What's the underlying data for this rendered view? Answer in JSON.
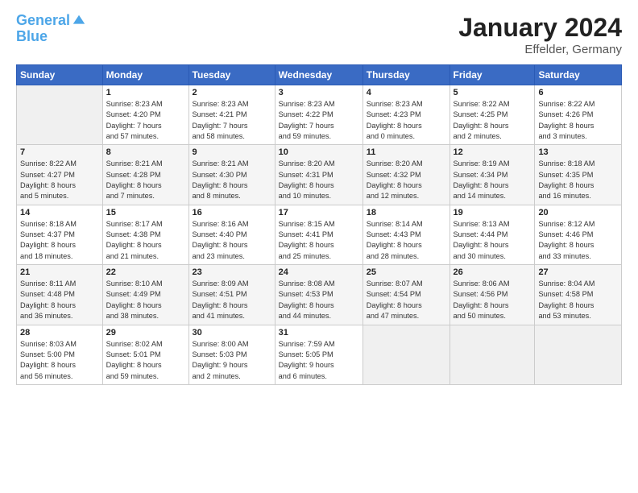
{
  "header": {
    "logo_line1": "General",
    "logo_line2": "Blue",
    "title": "January 2024",
    "subtitle": "Effelder, Germany"
  },
  "weekdays": [
    "Sunday",
    "Monday",
    "Tuesday",
    "Wednesday",
    "Thursday",
    "Friday",
    "Saturday"
  ],
  "weeks": [
    [
      {
        "num": "",
        "info": ""
      },
      {
        "num": "1",
        "info": "Sunrise: 8:23 AM\nSunset: 4:20 PM\nDaylight: 7 hours\nand 57 minutes."
      },
      {
        "num": "2",
        "info": "Sunrise: 8:23 AM\nSunset: 4:21 PM\nDaylight: 7 hours\nand 58 minutes."
      },
      {
        "num": "3",
        "info": "Sunrise: 8:23 AM\nSunset: 4:22 PM\nDaylight: 7 hours\nand 59 minutes."
      },
      {
        "num": "4",
        "info": "Sunrise: 8:23 AM\nSunset: 4:23 PM\nDaylight: 8 hours\nand 0 minutes."
      },
      {
        "num": "5",
        "info": "Sunrise: 8:22 AM\nSunset: 4:25 PM\nDaylight: 8 hours\nand 2 minutes."
      },
      {
        "num": "6",
        "info": "Sunrise: 8:22 AM\nSunset: 4:26 PM\nDaylight: 8 hours\nand 3 minutes."
      }
    ],
    [
      {
        "num": "7",
        "info": "Sunrise: 8:22 AM\nSunset: 4:27 PM\nDaylight: 8 hours\nand 5 minutes."
      },
      {
        "num": "8",
        "info": "Sunrise: 8:21 AM\nSunset: 4:28 PM\nDaylight: 8 hours\nand 7 minutes."
      },
      {
        "num": "9",
        "info": "Sunrise: 8:21 AM\nSunset: 4:30 PM\nDaylight: 8 hours\nand 8 minutes."
      },
      {
        "num": "10",
        "info": "Sunrise: 8:20 AM\nSunset: 4:31 PM\nDaylight: 8 hours\nand 10 minutes."
      },
      {
        "num": "11",
        "info": "Sunrise: 8:20 AM\nSunset: 4:32 PM\nDaylight: 8 hours\nand 12 minutes."
      },
      {
        "num": "12",
        "info": "Sunrise: 8:19 AM\nSunset: 4:34 PM\nDaylight: 8 hours\nand 14 minutes."
      },
      {
        "num": "13",
        "info": "Sunrise: 8:18 AM\nSunset: 4:35 PM\nDaylight: 8 hours\nand 16 minutes."
      }
    ],
    [
      {
        "num": "14",
        "info": "Sunrise: 8:18 AM\nSunset: 4:37 PM\nDaylight: 8 hours\nand 18 minutes."
      },
      {
        "num": "15",
        "info": "Sunrise: 8:17 AM\nSunset: 4:38 PM\nDaylight: 8 hours\nand 21 minutes."
      },
      {
        "num": "16",
        "info": "Sunrise: 8:16 AM\nSunset: 4:40 PM\nDaylight: 8 hours\nand 23 minutes."
      },
      {
        "num": "17",
        "info": "Sunrise: 8:15 AM\nSunset: 4:41 PM\nDaylight: 8 hours\nand 25 minutes."
      },
      {
        "num": "18",
        "info": "Sunrise: 8:14 AM\nSunset: 4:43 PM\nDaylight: 8 hours\nand 28 minutes."
      },
      {
        "num": "19",
        "info": "Sunrise: 8:13 AM\nSunset: 4:44 PM\nDaylight: 8 hours\nand 30 minutes."
      },
      {
        "num": "20",
        "info": "Sunrise: 8:12 AM\nSunset: 4:46 PM\nDaylight: 8 hours\nand 33 minutes."
      }
    ],
    [
      {
        "num": "21",
        "info": "Sunrise: 8:11 AM\nSunset: 4:48 PM\nDaylight: 8 hours\nand 36 minutes."
      },
      {
        "num": "22",
        "info": "Sunrise: 8:10 AM\nSunset: 4:49 PM\nDaylight: 8 hours\nand 38 minutes."
      },
      {
        "num": "23",
        "info": "Sunrise: 8:09 AM\nSunset: 4:51 PM\nDaylight: 8 hours\nand 41 minutes."
      },
      {
        "num": "24",
        "info": "Sunrise: 8:08 AM\nSunset: 4:53 PM\nDaylight: 8 hours\nand 44 minutes."
      },
      {
        "num": "25",
        "info": "Sunrise: 8:07 AM\nSunset: 4:54 PM\nDaylight: 8 hours\nand 47 minutes."
      },
      {
        "num": "26",
        "info": "Sunrise: 8:06 AM\nSunset: 4:56 PM\nDaylight: 8 hours\nand 50 minutes."
      },
      {
        "num": "27",
        "info": "Sunrise: 8:04 AM\nSunset: 4:58 PM\nDaylight: 8 hours\nand 53 minutes."
      }
    ],
    [
      {
        "num": "28",
        "info": "Sunrise: 8:03 AM\nSunset: 5:00 PM\nDaylight: 8 hours\nand 56 minutes."
      },
      {
        "num": "29",
        "info": "Sunrise: 8:02 AM\nSunset: 5:01 PM\nDaylight: 8 hours\nand 59 minutes."
      },
      {
        "num": "30",
        "info": "Sunrise: 8:00 AM\nSunset: 5:03 PM\nDaylight: 9 hours\nand 2 minutes."
      },
      {
        "num": "31",
        "info": "Sunrise: 7:59 AM\nSunset: 5:05 PM\nDaylight: 9 hours\nand 6 minutes."
      },
      {
        "num": "",
        "info": ""
      },
      {
        "num": "",
        "info": ""
      },
      {
        "num": "",
        "info": ""
      }
    ]
  ]
}
